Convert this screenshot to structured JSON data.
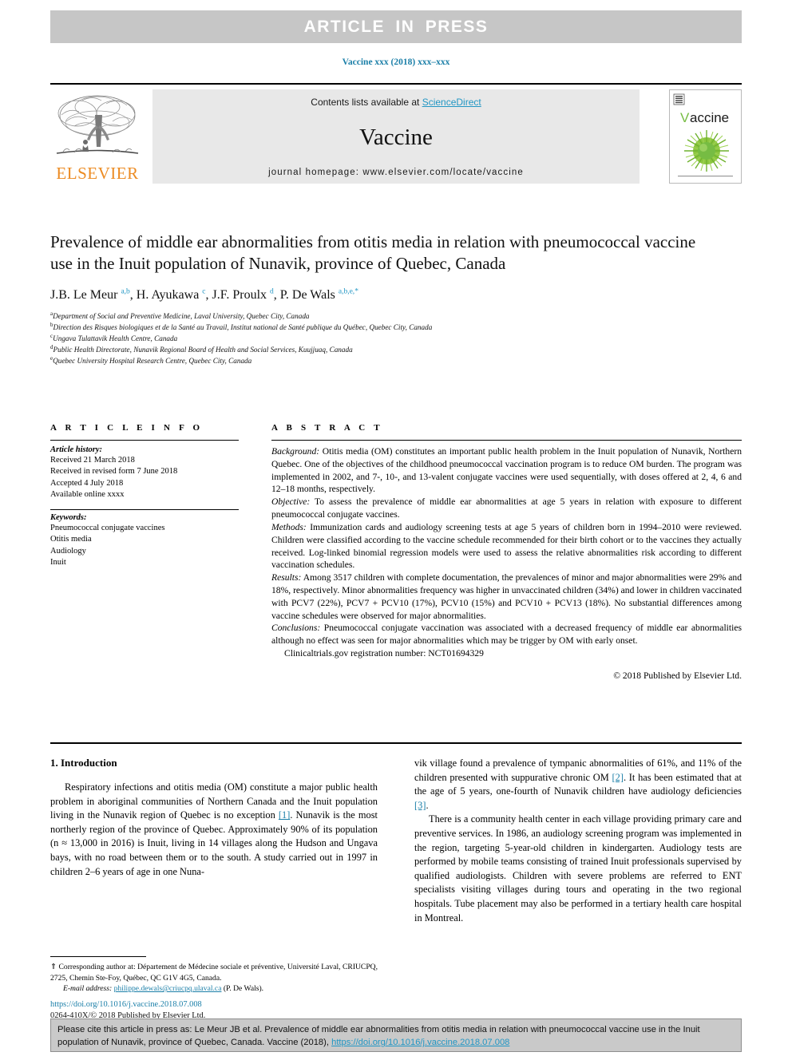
{
  "banner": {
    "text": "ARTICLE  IN  PRESS"
  },
  "running_head": "Vaccine xxx (2018) xxx–xxx",
  "masthead": {
    "contents_prefix": "Contents lists available at ",
    "sciencedirect": "ScienceDirect",
    "journal_name": "Vaccine",
    "homepage": "journal homepage: www.elsevier.com/locate/vaccine",
    "publisher_wordmark": "ELSEVIER",
    "cover_title": "Vaccine"
  },
  "article": {
    "title": "Prevalence of middle ear abnormalities from otitis media in relation with pneumococcal vaccine use in the Inuit population of Nunavik, province of Quebec, Canada",
    "authors_html": "J.B. Le Meur <sup>a,b</sup>, H. Ayukawa <sup>c</sup>, J.F. Proulx <sup>d</sup>, P. De Wals <sup>a,b,e,</sup><sup>*</sup>",
    "affiliations": [
      {
        "marker": "a",
        "text": "Department of Social and Preventive Medicine, Laval University, Quebec City, Canada"
      },
      {
        "marker": "b",
        "text": "Direction des Risques biologiques et de la Santé au Travail, Institut national de Santé publique du Québec, Quebec City, Canada"
      },
      {
        "marker": "c",
        "text": "Ungava Tulattavik Health Centre, Canada"
      },
      {
        "marker": "d",
        "text": "Public Health Directorate, Nunavik Regional Board of Health and Social Services, Kuujjuaq, Canada"
      },
      {
        "marker": "e",
        "text": "Quebec University Hospital Research Centre, Quebec City, Canada"
      }
    ]
  },
  "article_info": {
    "heading": "A R T I C L E  I N F O",
    "history_label": "Article history:",
    "history": [
      "Received 21 March 2018",
      "Received in revised form 7 June 2018",
      "Accepted 4 July 2018",
      "Available online xxxx"
    ],
    "keywords_label": "Keywords:",
    "keywords": [
      "Pneumococcal conjugate vaccines",
      "Otitis media",
      "Audiology",
      "Inuit"
    ]
  },
  "abstract": {
    "heading": "A B S T R A C T",
    "sections": [
      {
        "label": "Background:",
        "text": " Otitis media (OM) constitutes an important public health problem in the Inuit population of Nunavik, Northern Quebec. One of the objectives of the childhood pneumococcal vaccination program is to reduce OM burden. The program was implemented in 2002, and 7-, 10-, and 13-valent conjugate vaccines were used sequentially, with doses offered at 2, 4, 6 and 12–18 months, respectively."
      },
      {
        "label": "Objective:",
        "text": " To assess the prevalence of middle ear abnormalities at age 5 years in relation with exposure to different pneumococcal conjugate vaccines."
      },
      {
        "label": "Methods:",
        "text": " Immunization cards and audiology screening tests at age 5 years of children born in 1994–2010 were reviewed. Children were classified according to the vaccine schedule recommended for their birth cohort or to the vaccines they actually received. Log-linked binomial regression models were used to assess the relative abnormalities risk according to different vaccination schedules."
      },
      {
        "label": "Results:",
        "text": " Among 3517 children with complete documentation, the prevalences of minor and major abnormalities were 29% and 18%, respectively. Minor abnormalities frequency was higher in unvaccinated children (34%) and lower in children vaccinated with PCV7 (22%), PCV7 + PCV10 (17%), PCV10 (15%) and PCV10 + PCV13 (18%). No substantial differences among vaccine schedules were observed for major abnormalities."
      },
      {
        "label": "Conclusions:",
        "text": " Pneumococcal conjugate vaccination was associated with a decreased frequency of middle ear abnormalities although no effect was seen for major abnormalities which may be trigger by OM with early onset."
      }
    ],
    "trial_registration": "Clinicaltrials.gov registration number: NCT01694329",
    "copyright": "© 2018 Published by Elsevier Ltd."
  },
  "introduction": {
    "heading": "1. Introduction",
    "left_paragraphs": [
      {
        "pre": "Respiratory infections and otitis media (OM) constitute a major public health problem in aboriginal communities of Northern Canada and the Inuit population living in the Nunavik region of Quebec is no exception ",
        "ref": "[1]",
        "post": ". Nunavik is the most northerly region of the province of Quebec. Approximately 90% of its population (n ≈ 13,000 in 2016) is Inuit, living in 14 villages along the Hudson and Ungava bays, with no road between them or to the south. A study carried out in 1997 in children 2–6 years of age in one Nuna-"
      }
    ],
    "right_paragraphs": [
      {
        "pre": "vik village found a prevalence of tympanic abnormalities of 61%, and 11% of the children presented with suppurative chronic OM ",
        "ref": "[2]",
        "mid": ". It has been estimated that at the age of 5 years, one-fourth of Nunavik children have audiology deficiencies ",
        "ref2": "[3]",
        "post": "."
      },
      {
        "pre": "There is a community health center in each village providing primary care and preventive services. In 1986, an audiology screening program was implemented in the region, targeting 5-year-old children in kindergarten. Audiology tests are performed by mobile teams consisting of trained Inuit professionals supervised by qualified audiologists. Children with severe problems are referred to ENT specialists visiting villages during tours and operating in the two regional hospitals. Tube placement may also be performed in a tertiary health care hospital in Montreal.",
        "ref": "",
        "post": ""
      }
    ]
  },
  "footnote": {
    "star": "⇑",
    "corresponding": " Corresponding author at: Département de Médecine sociale et préventive, Université Laval, CRIUCPQ, 2725, Chemin Ste-Foy, Québec, QC G1V 4G5, Canada.",
    "email_label": "E-mail address:",
    "email": "philippe.dewals@criucpq.ulaval.ca",
    "email_suffix": " (P. De Wals)."
  },
  "doi": {
    "url": "https://doi.org/10.1016/j.vaccine.2018.07.008",
    "issn_line": "0264-410X/© 2018 Published by Elsevier Ltd."
  },
  "cite_box": {
    "pre": "Please cite this article in press as: Le Meur JB et al. Prevalence of middle ear abnormalities from otitis media in relation with pneumococcal vaccine use in the Inuit population of Nunavik, province of Quebec, Canada. Vaccine (2018), ",
    "link": "https://doi.org/10.1016/j.vaccine.2018.07.008"
  },
  "colors": {
    "link_blue": "#1b7fa8",
    "sciencedirect_blue": "#2196c4",
    "elsevier_orange": "#ec8b22",
    "banner_gray": "#c6c6c6",
    "band_gray": "#e8e8e8",
    "cite_box_gray": "#c9c9c9",
    "cover_green": "#76bc43"
  }
}
